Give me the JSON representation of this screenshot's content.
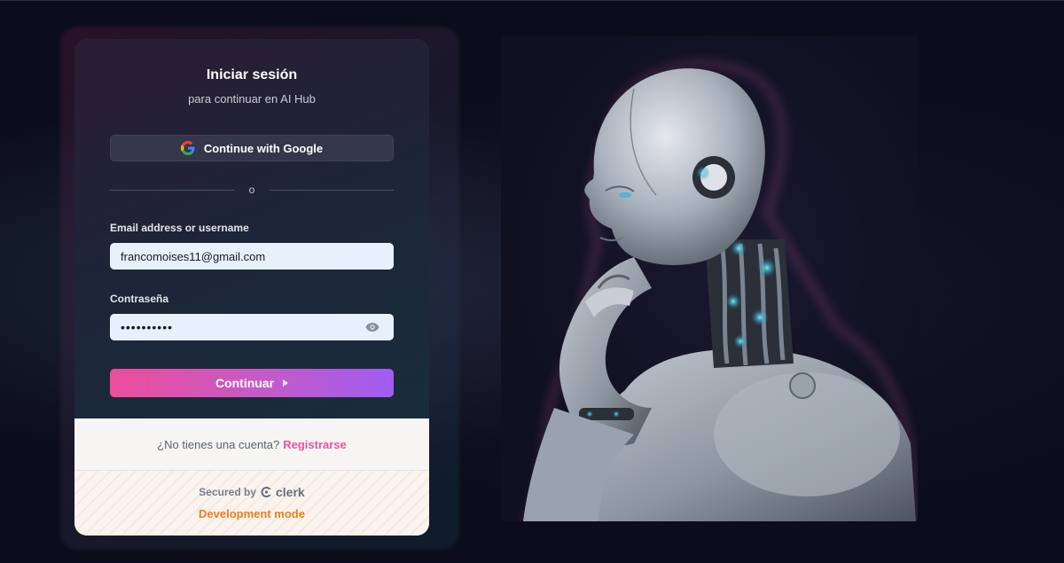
{
  "signin": {
    "title": "Iniciar sesión",
    "subtitle": "para continuar en AI Hub",
    "google_button": "Continue with Google",
    "divider": "o",
    "email_label": "Email address or username",
    "email_value": "francomoises11@gmail.com",
    "password_label": "Contraseña",
    "password_value": "••••••••••",
    "continue_button": "Continuar",
    "no_account_text": "¿No tienes una cuenta?",
    "signup_link": "Registrarse",
    "secured_by": "Secured by",
    "clerk_brand": "clerk",
    "dev_mode": "Development mode"
  },
  "icons": {
    "google": "google-icon",
    "eye": "eye-icon",
    "arrow": "arrow-right-icon",
    "clerk": "clerk-icon"
  },
  "colors": {
    "background": "#0b0d1a",
    "accent_pink": "#ec4d9b",
    "accent_purple": "#a05cf0",
    "link": "#e8559c",
    "dev_mode": "#f07d1c",
    "input_bg": "#e8f0fe"
  }
}
